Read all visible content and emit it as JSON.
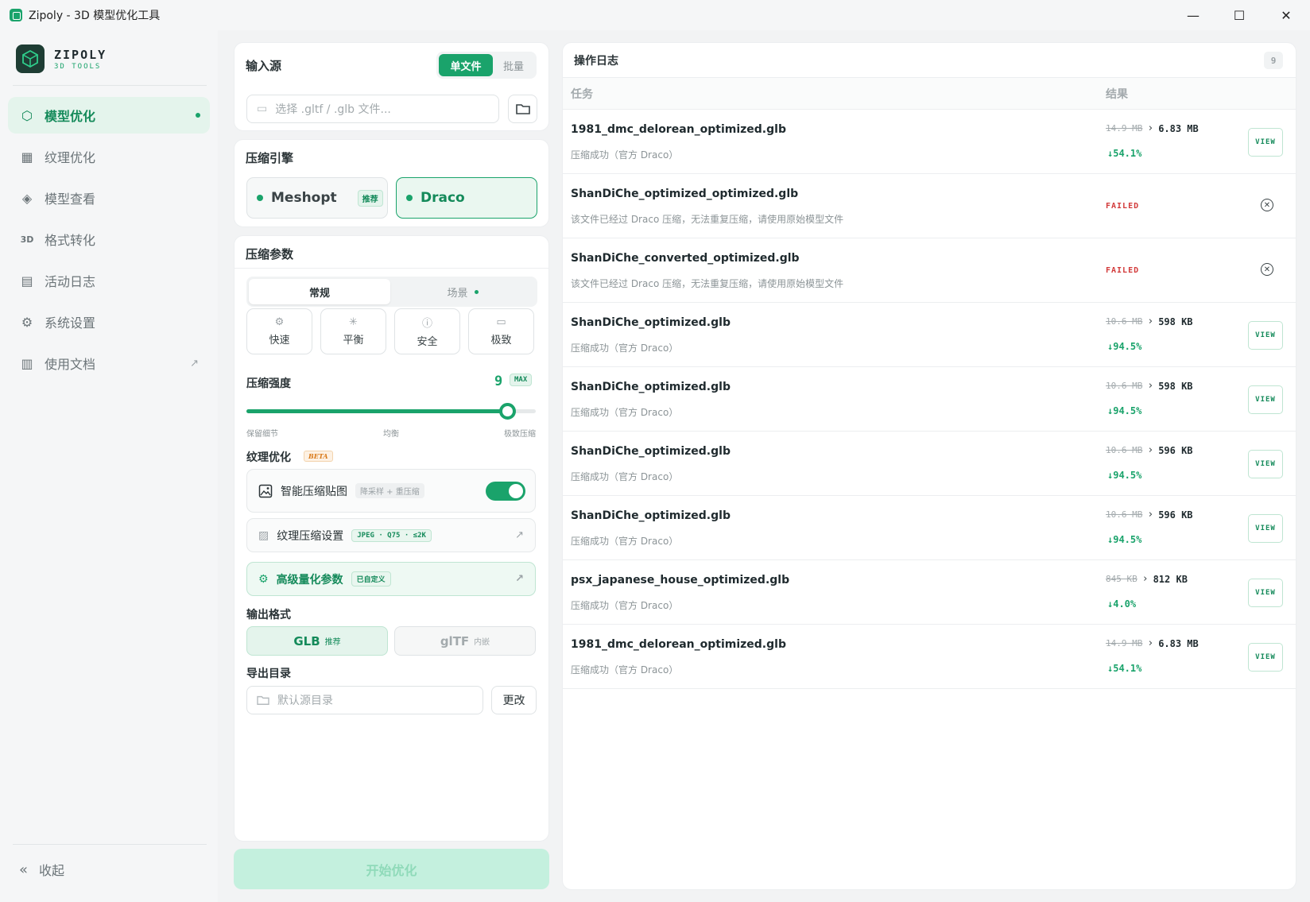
{
  "window": {
    "title": "Zipoly - 3D 模型优化工具",
    "minimize": "—",
    "maximize": "☐",
    "close": "✕"
  },
  "brand": {
    "name": "ZIPOLY",
    "sub": "3D TOOLS"
  },
  "sidebar": {
    "items": [
      {
        "label": "模型优化",
        "icon": "cube-icon",
        "glyph": "⬡",
        "active": true
      },
      {
        "label": "纹理优化",
        "icon": "checker-icon",
        "glyph": "▦"
      },
      {
        "label": "模型查看",
        "icon": "viewer-icon",
        "glyph": "◈"
      },
      {
        "label": "格式转化",
        "icon": "3d-icon",
        "glyph": "3D"
      },
      {
        "label": "活动日志",
        "icon": "calendar-icon",
        "glyph": "▤"
      },
      {
        "label": "系统设置",
        "icon": "gear-icon",
        "glyph": "⚙"
      },
      {
        "label": "使用文档",
        "icon": "document-icon",
        "glyph": "▥",
        "external": "↗"
      }
    ],
    "collapse_label": "收起",
    "collapse_glyph": "«"
  },
  "input_source": {
    "title": "输入源",
    "mode_single": "单文件",
    "mode_batch": "批量",
    "placeholder": "选择 .gltf / .glb 文件..."
  },
  "engine": {
    "title": "压缩引擎",
    "meshopt": "Meshopt",
    "meshopt_badge": "推荐",
    "draco": "Draco"
  },
  "params": {
    "title": "压缩参数",
    "tab_normal": "常规",
    "tab_scene": "场景",
    "presets": [
      {
        "label": "快速",
        "icon": "chip-icon",
        "glyph": "⚙"
      },
      {
        "label": "平衡",
        "icon": "spark-icon",
        "glyph": "✳"
      },
      {
        "label": "安全",
        "icon": "alert-icon",
        "glyph": "ⓘ"
      },
      {
        "label": "极致",
        "icon": "monitor-icon",
        "glyph": "▭"
      }
    ],
    "strength_label": "压缩强度",
    "strength_value": "9",
    "strength_max_badge": "MAX",
    "strength_fraction": 0.9,
    "slider_low": "保留细节",
    "slider_mid": "均衡",
    "slider_high": "极致压缩"
  },
  "texture": {
    "title": "纹理优化",
    "beta": "BETA",
    "smart_label": "智能压缩贴图",
    "smart_chip": "降采样 + 重压缩",
    "settings_label": "纹理压缩设置",
    "settings_chip": "JPEG · Q75 · ≤2K",
    "advanced_label": "高级量化参数",
    "advanced_chip": "已自定义",
    "ext": "↗"
  },
  "output": {
    "title": "输出格式",
    "glb": "GLB",
    "glb_note": "推荐",
    "gltf": "glTF",
    "gltf_note": "内嵌",
    "dir_title": "导出目录",
    "dir_placeholder": "默认源目录",
    "dir_change": "更改"
  },
  "start_button": "开始优化",
  "log": {
    "title": "操作日志",
    "count": "9",
    "col_task": "任务",
    "col_result": "结果",
    "view_label": "VIEW",
    "failed_label": "FAILED",
    "rows": [
      {
        "name": "1981_dmc_delorean_optimized.glb",
        "msg": "压缩成功（官方 Draco）",
        "old": "14.9 MB",
        "new": "6.83 MB",
        "pct": "54.1%",
        "status": "ok"
      },
      {
        "name": "ShanDiChe_optimized_optimized.glb",
        "msg": "该文件已经过 Draco 压缩，无法重复压缩，请使用原始模型文件",
        "status": "failed"
      },
      {
        "name": "ShanDiChe_converted_optimized.glb",
        "msg": "该文件已经过 Draco 压缩，无法重复压缩，请使用原始模型文件",
        "status": "failed"
      },
      {
        "name": "ShanDiChe_optimized.glb",
        "msg": "压缩成功（官方 Draco）",
        "old": "10.6 MB",
        "new": "598 KB",
        "pct": "94.5%",
        "status": "ok"
      },
      {
        "name": "ShanDiChe_optimized.glb",
        "msg": "压缩成功（官方 Draco）",
        "old": "10.6 MB",
        "new": "598 KB",
        "pct": "94.5%",
        "status": "ok"
      },
      {
        "name": "ShanDiChe_optimized.glb",
        "msg": "压缩成功（官方 Draco）",
        "old": "10.6 MB",
        "new": "596 KB",
        "pct": "94.5%",
        "status": "ok"
      },
      {
        "name": "ShanDiChe_optimized.glb",
        "msg": "压缩成功（官方 Draco）",
        "old": "10.6 MB",
        "new": "596 KB",
        "pct": "94.5%",
        "status": "ok"
      },
      {
        "name": "psx_japanese_house_optimized.glb",
        "msg": "压缩成功（官方 Draco）",
        "old": "845 KB",
        "new": "812 KB",
        "pct": "4.0%",
        "status": "ok"
      },
      {
        "name": "1981_dmc_delorean_optimized.glb",
        "msg": "压缩成功（官方 Draco）",
        "old": "14.9 MB",
        "new": "6.83 MB",
        "pct": "54.1%",
        "status": "ok"
      }
    ]
  },
  "colors": {
    "accent": "#1aa36b",
    "danger": "#d23a3a",
    "start_disabled": "#c4f0de"
  }
}
